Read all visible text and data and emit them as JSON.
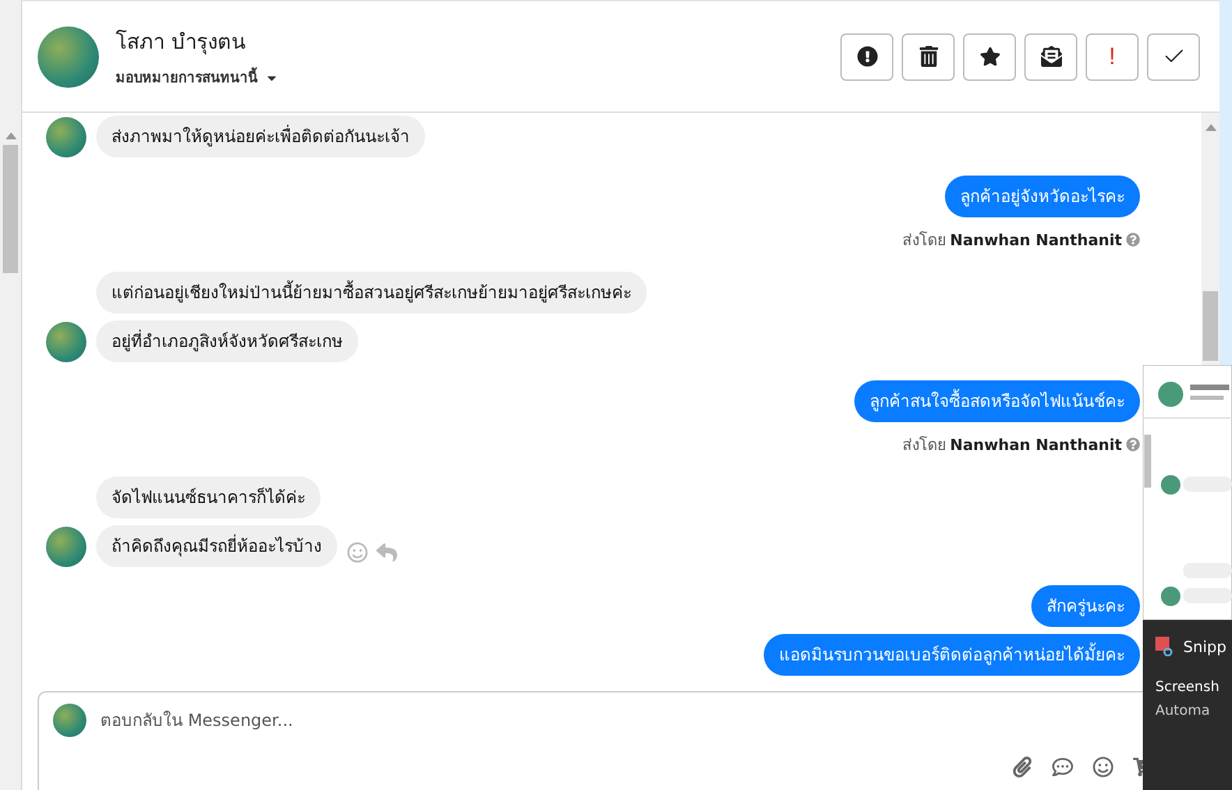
{
  "header": {
    "name": "โสภา บำรุงตน",
    "assign_label": "มอบหมายการสนทนานี้",
    "actions": [
      {
        "kind": "alert"
      },
      {
        "kind": "trash"
      },
      {
        "kind": "star"
      },
      {
        "kind": "mail"
      },
      {
        "kind": "mark",
        "text": "!"
      },
      {
        "kind": "check"
      }
    ]
  },
  "messages": [
    {
      "kind": "incoming",
      "avatar": true,
      "text": "ส่งภาพมาให้ดูหน่อยค่ะเพื่อติดต่อกันนะเจ้า"
    },
    {
      "kind": "outgoing",
      "text": "ลูกค้าอยู่จังหวัดอะไรคะ",
      "sent_by": {
        "prefix": "ส่งโดย",
        "name": "Nanwhan Nanthanit"
      }
    },
    {
      "kind": "incoming",
      "avatar": false,
      "text": "แต่ก่อนอยู่เชียงใหม่ป่านนี้ย้ายมาซื้อสวนอยู่ศรีสะเกษย้ายมาอยู่ศรีสะเกษค่ะ"
    },
    {
      "kind": "incoming",
      "avatar": true,
      "text": "อยู่ที่อำเภอภูสิงห์จังหวัดศรีสะเกษ"
    },
    {
      "kind": "outgoing",
      "text": "ลูกค้าสนใจซื้อสดหรือจัดไฟแน้นช์คะ",
      "sent_by": {
        "prefix": "ส่งโดย",
        "name": "Nanwhan Nanthanit"
      }
    },
    {
      "kind": "incoming",
      "avatar": false,
      "text": "จัดไฟแนนซ์ธนาคารก็ได้ค่ะ"
    },
    {
      "kind": "incoming",
      "avatar": true,
      "text": "ถ้าคิดถึงคุณมีรถยี่ห้ออะไรบ้าง",
      "reactions": true
    },
    {
      "kind": "outgoing",
      "text": "สักครู่นะคะ"
    },
    {
      "kind": "outgoing",
      "text": "แอดมินรบกวนขอเบอร์ติดต่อลูกค้าหน่อยได้มั้ยคะ"
    }
  ],
  "composer": {
    "placeholder": "ตอบกลับใน Messenger..."
  },
  "snip_notification": {
    "app": "Snipp",
    "line_1": "Screensh",
    "line_2": "Automa"
  }
}
